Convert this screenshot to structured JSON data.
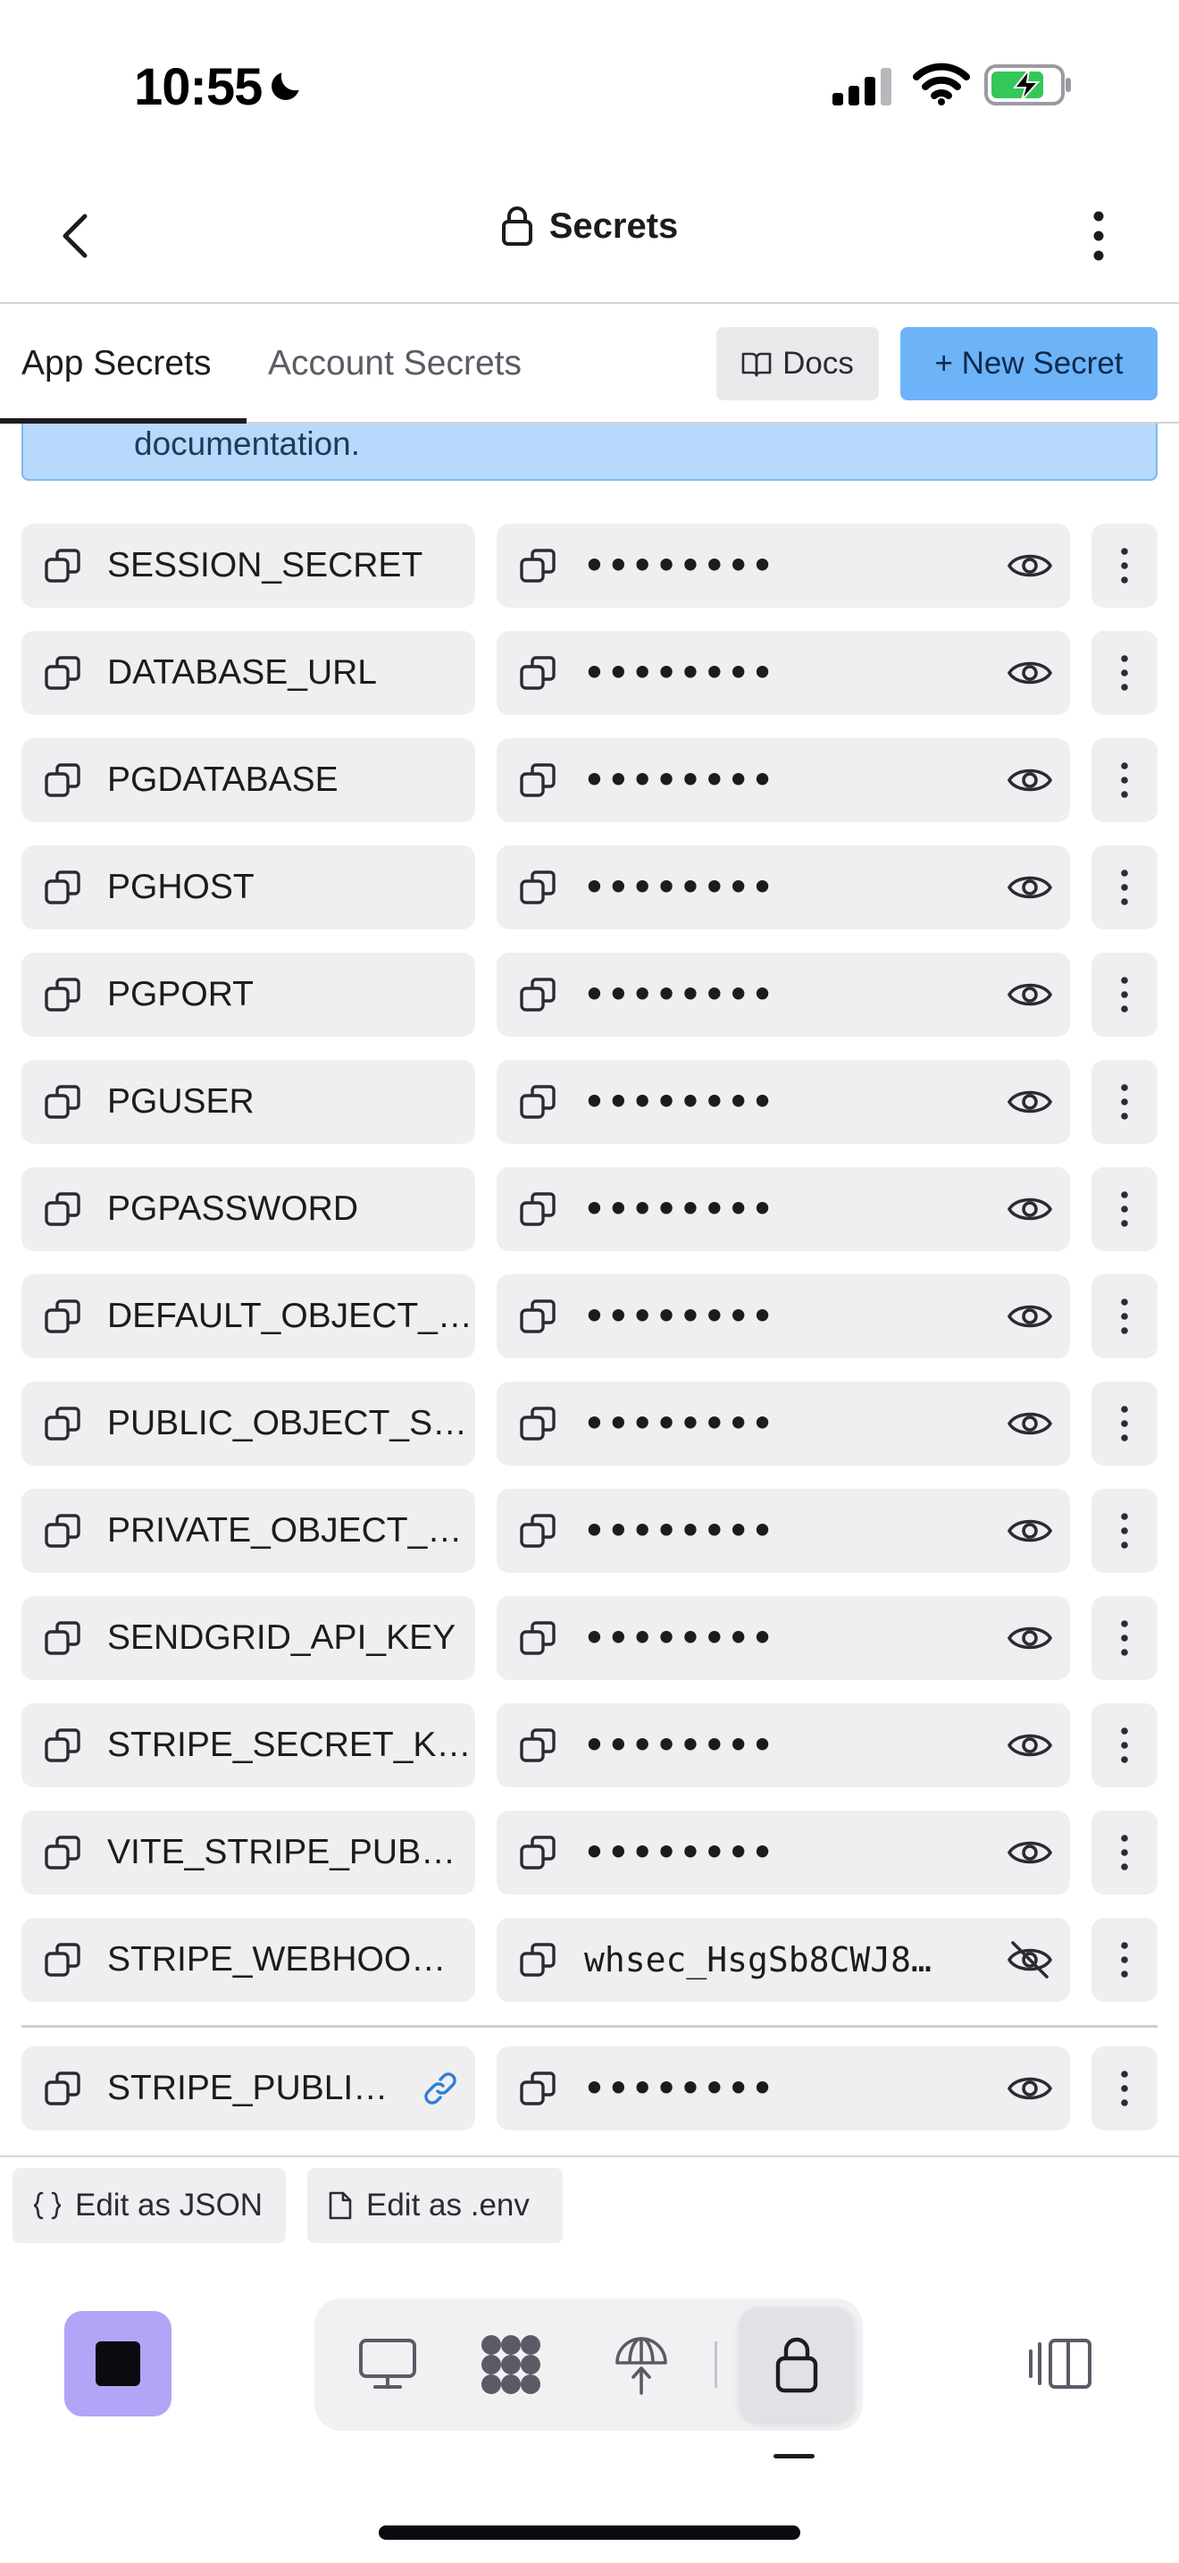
{
  "status_bar": {
    "time": "10:55"
  },
  "header": {
    "title": "Secrets"
  },
  "tabs": [
    {
      "label": "App Secrets",
      "active": true
    },
    {
      "label": "Account Secrets",
      "active": false
    }
  ],
  "actions": {
    "docs_label": "Docs",
    "new_secret_label": "+ New Secret"
  },
  "banner": {
    "text": "documentation."
  },
  "secrets": [
    {
      "key": "SESSION_SECRET",
      "value": "••••••••",
      "revealed": false
    },
    {
      "key": "DATABASE_URL",
      "value": "••••••••",
      "revealed": false
    },
    {
      "key": "PGDATABASE",
      "value": "••••••••",
      "revealed": false
    },
    {
      "key": "PGHOST",
      "value": "••••••••",
      "revealed": false
    },
    {
      "key": "PGPORT",
      "value": "••••••••",
      "revealed": false
    },
    {
      "key": "PGUSER",
      "value": "••••••••",
      "revealed": false
    },
    {
      "key": "PGPASSWORD",
      "value": "••••••••",
      "revealed": false
    },
    {
      "key": "DEFAULT_OBJECT_…",
      "value": "••••••••",
      "revealed": false
    },
    {
      "key": "PUBLIC_OBJECT_S…",
      "value": "••••••••",
      "revealed": false
    },
    {
      "key": "PRIVATE_OBJECT_…",
      "value": "••••••••",
      "revealed": false
    },
    {
      "key": "SENDGRID_API_KEY",
      "value": "••••••••",
      "revealed": false
    },
    {
      "key": "STRIPE_SECRET_K…",
      "value": "••••••••",
      "revealed": false
    },
    {
      "key": "VITE_STRIPE_PUB…",
      "value": "••••••••",
      "revealed": false
    },
    {
      "key": "STRIPE_WEBHOO…",
      "value": "whsec_HsgSb8CWJ8…",
      "revealed": true
    }
  ],
  "linked_secret": {
    "key": "STRIPE_PUBLI…",
    "value": "••••••••",
    "revealed": false
  },
  "footer": {
    "edit_json_label": "Edit as JSON",
    "edit_env_label": "Edit as .env"
  },
  "icons": {
    "back": "chevron-left-icon",
    "lock": "lock-icon",
    "more": "more-vertical-icon",
    "docs": "book-icon",
    "copy": "copy-icon",
    "eye": "eye-icon",
    "eye_off": "eye-off-icon",
    "link": "link-icon",
    "json": "braces-icon",
    "env": "file-icon",
    "stop": "stop-icon",
    "preview": "monitor-icon",
    "workspace": "grid-icon",
    "deploy": "deploy-icon",
    "secrets": "lock-icon",
    "layout": "layout-icon"
  },
  "colors": {
    "accent": "#6db3f8",
    "banner": "#b7d9fb",
    "stop": "#b2a5f7",
    "link": "#2f7fd6"
  }
}
